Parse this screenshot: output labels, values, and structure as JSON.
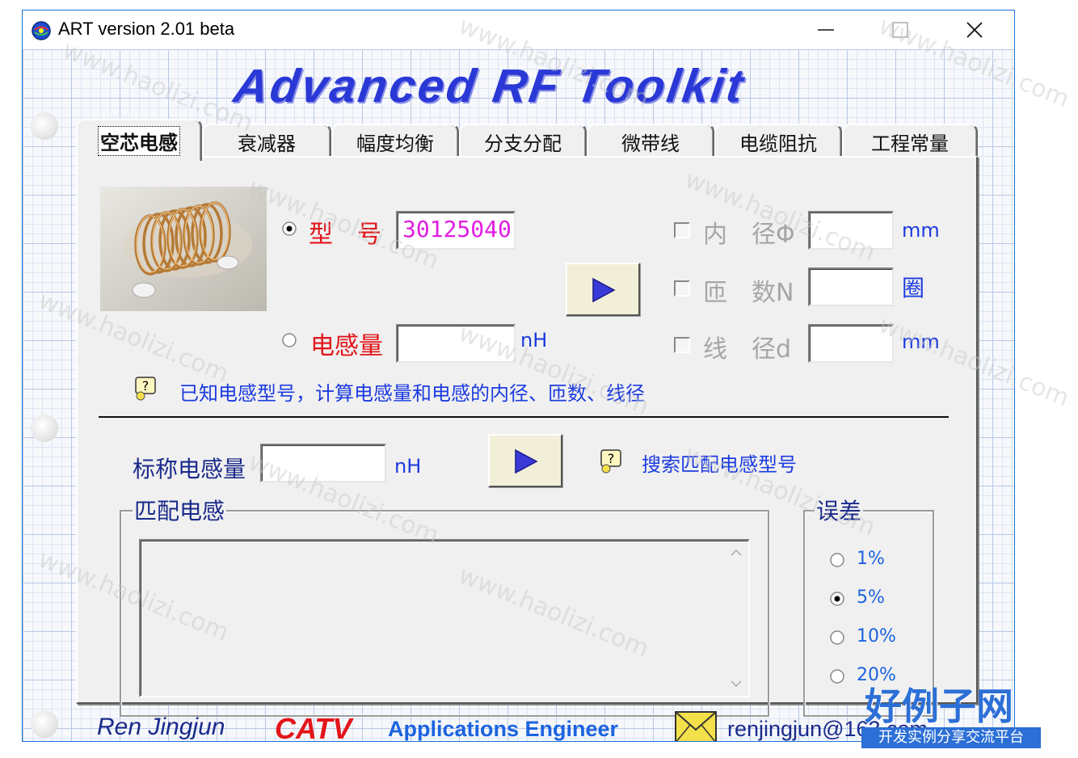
{
  "window": {
    "title": "ART version 2.01 beta"
  },
  "header": {
    "title": "Advanced RF Toolkit"
  },
  "tabs": [
    {
      "label": "空芯电感",
      "active": true
    },
    {
      "label": "衰减器",
      "active": false
    },
    {
      "label": "幅度均衡",
      "active": false
    },
    {
      "label": "分支分配",
      "active": false
    },
    {
      "label": "微带线",
      "active": false
    },
    {
      "label": "电缆阻抗",
      "active": false
    },
    {
      "label": "工程常量",
      "active": false
    }
  ],
  "inductor": {
    "model_label": "型　号",
    "model_value": "30125040",
    "inductance_label": "电感量",
    "inductance_unit": "nH",
    "inner_diameter_label": "内　径Φ",
    "inner_diameter_unit": "mm",
    "turns_label": "匝　数N",
    "turns_unit": "圈",
    "wire_diameter_label": "线　径d",
    "wire_diameter_unit": "mm",
    "hint": "已知电感型号，计算电感量和电感的内径、匝数、线径"
  },
  "search": {
    "nominal_label": "标称电感量",
    "nominal_unit": "nH",
    "hint": "搜索匹配电感型号"
  },
  "match_group": {
    "title": "匹配电感"
  },
  "tolerance": {
    "title": "误差",
    "options": [
      "1%",
      "5%",
      "10%",
      "20%"
    ],
    "selected": "5%"
  },
  "footer": {
    "author": "Ren Jingjun",
    "brand": "CATV",
    "role": "Applications Engineer",
    "email": "renjingjun@163.com"
  },
  "watermark": {
    "text": "www.haolizi.com",
    "logo_title": "好例子网",
    "logo_subtitle": "开发实例分享交流平台"
  },
  "colors": {
    "title_blue": "#2a38d6",
    "label_red": "#e3151a",
    "label_blue": "#1c3bdf",
    "field_magenta": "#e11de1",
    "catv_red": "#e3151a",
    "window_border": "#1a73d9"
  }
}
